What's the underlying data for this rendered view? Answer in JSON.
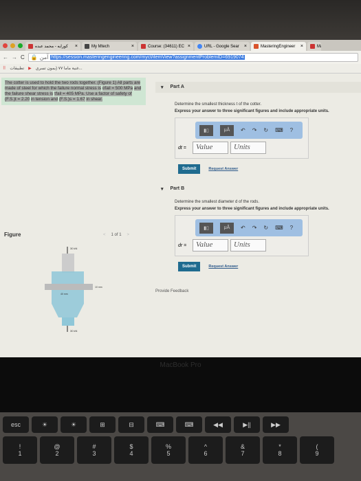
{
  "browser": {
    "tabs": [
      {
        "label": "كورايه - محمد عبده"
      },
      {
        "label": "My Mtech"
      },
      {
        "label": "Course: (34611) EC"
      },
      {
        "label": "URL - Google Sear"
      },
      {
        "label": "MasteringEngineer"
      },
      {
        "label": "Ma"
      }
    ],
    "secure_label": "آمن",
    "url": "https://session.masteringengineering.com/myct/itemView?assignmentProblemID=6919074",
    "bookmarks": [
      {
        "label": "تطبيقات"
      },
      {
        "label": "غنية ماما ٧٧ (يمون تسري..."
      }
    ]
  },
  "problem": {
    "line1": "The cotter is used to hold the two rods together. (Figure 1) All parts are made of steel for which the failure normal stress is",
    "sigma": "σfail = 500 MPa",
    "line2": "and the failure shear stress is",
    "tau": "τfail = 405 MPa",
    "line3": ". Use a factor of safety of",
    "fst": "(F.S.)t = 2.20",
    "line4": "in tension and",
    "fss": "(F.S.)s = 1.67",
    "line5": "in shear."
  },
  "figure": {
    "title": "Figure",
    "pager": "1 of 1",
    "prev": "<",
    "next": ">",
    "force_top": "30 kN",
    "force_bottom": "30 kN",
    "dim_10": "10 mm",
    "dim_40": "40 mm",
    "label_d": "d",
    "label_t": "t"
  },
  "partA": {
    "title": "Part A",
    "question": "Determine the smallest thickness t of the cotter.",
    "instruction": "Express your answer to three significant figures and include appropriate units.",
    "var": "dt =",
    "value_placeholder": "Value",
    "units_placeholder": "Units",
    "submit": "Submit",
    "request": "Request Answer"
  },
  "partB": {
    "title": "Part B",
    "question": "Determine the smallest diameter d of the rods.",
    "instruction": "Express your answer to three significant figures and include appropriate units.",
    "var": "dr =",
    "value_placeholder": "Value",
    "units_placeholder": "Units",
    "submit": "Submit",
    "request": "Request Answer"
  },
  "toolbar": {
    "mu": "μÅ",
    "help": "?",
    "undo": "↶",
    "redo": "↷",
    "reset": "↻",
    "keyboard": "⌨"
  },
  "feedback": "Provide Feedback",
  "laptop_label": "MacBook Pro",
  "keys": {
    "fn": [
      "esc",
      "☀",
      "☀",
      "⊞",
      "⊟",
      "⌨",
      "⌨",
      "◀◀",
      "▶||",
      "▶▶"
    ],
    "num": [
      [
        "!",
        "1"
      ],
      [
        "@",
        "2"
      ],
      [
        "#",
        "3"
      ],
      [
        "$",
        "4"
      ],
      [
        "%",
        "5"
      ],
      [
        "^",
        "6"
      ],
      [
        "&",
        "7"
      ],
      [
        "*",
        "8"
      ],
      [
        "(",
        "9"
      ]
    ]
  },
  "colors": {
    "submit": "#1f6b8f",
    "problem_bg": "#cfe6d3",
    "toolbar": "#9fbfe2",
    "url_highlight": "#3b7be0"
  }
}
